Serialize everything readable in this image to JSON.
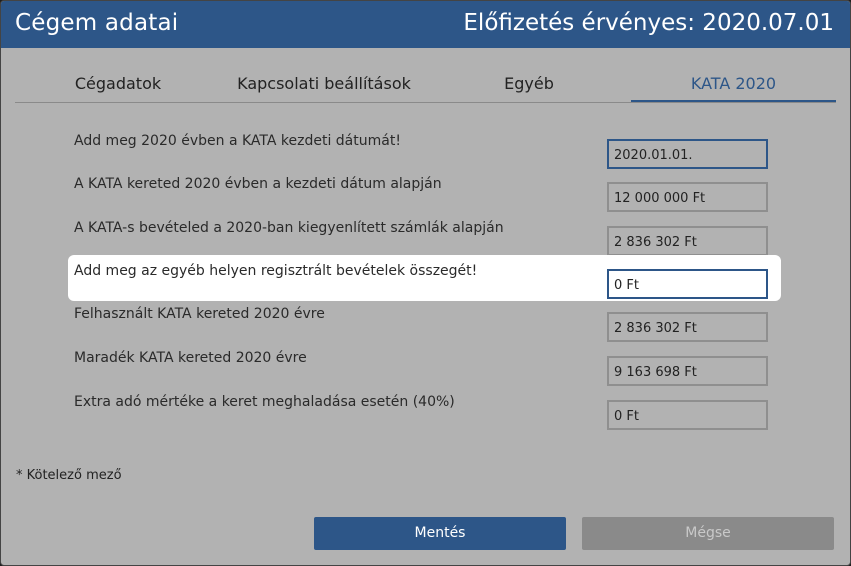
{
  "header": {
    "title": "Cégem adatai",
    "subscription": "Előfizetés érvényes: 2020.07.01"
  },
  "tabs": [
    {
      "label": "Cégadatok"
    },
    {
      "label": "Kapcsolati beállítások"
    },
    {
      "label": "Egyéb"
    },
    {
      "label": "KATA 2020"
    }
  ],
  "rows": [
    {
      "label": "Add meg 2020 évben a KATA kezdeti dátumát!",
      "value": "2020.01.01."
    },
    {
      "label": "A KATA kereted 2020 évben a kezdeti dátum alapján",
      "value": "12 000 000 Ft"
    },
    {
      "label": "A KATA-s bevételed a 2020-ban kiegyenlített számlák alapján",
      "value": "2 836 302 Ft"
    },
    {
      "label": "Add meg az egyéb helyen regisztrált bevételek összegét!",
      "value": "0 Ft"
    },
    {
      "label": "Felhasznált KATA kereted 2020 évre",
      "value": "2 836 302 Ft"
    },
    {
      "label": "Maradék KATA kereted 2020 évre",
      "value": "9 163 698 Ft"
    },
    {
      "label": "Extra adó mértéke a keret meghaladása esetén (40%)",
      "value": "0 Ft"
    }
  ],
  "required_note": "* Kötelező mező",
  "buttons": {
    "save": "Mentés",
    "cancel": "Mégse"
  },
  "colors": {
    "accent": "#2d5688",
    "background": "#b2b2b2"
  }
}
